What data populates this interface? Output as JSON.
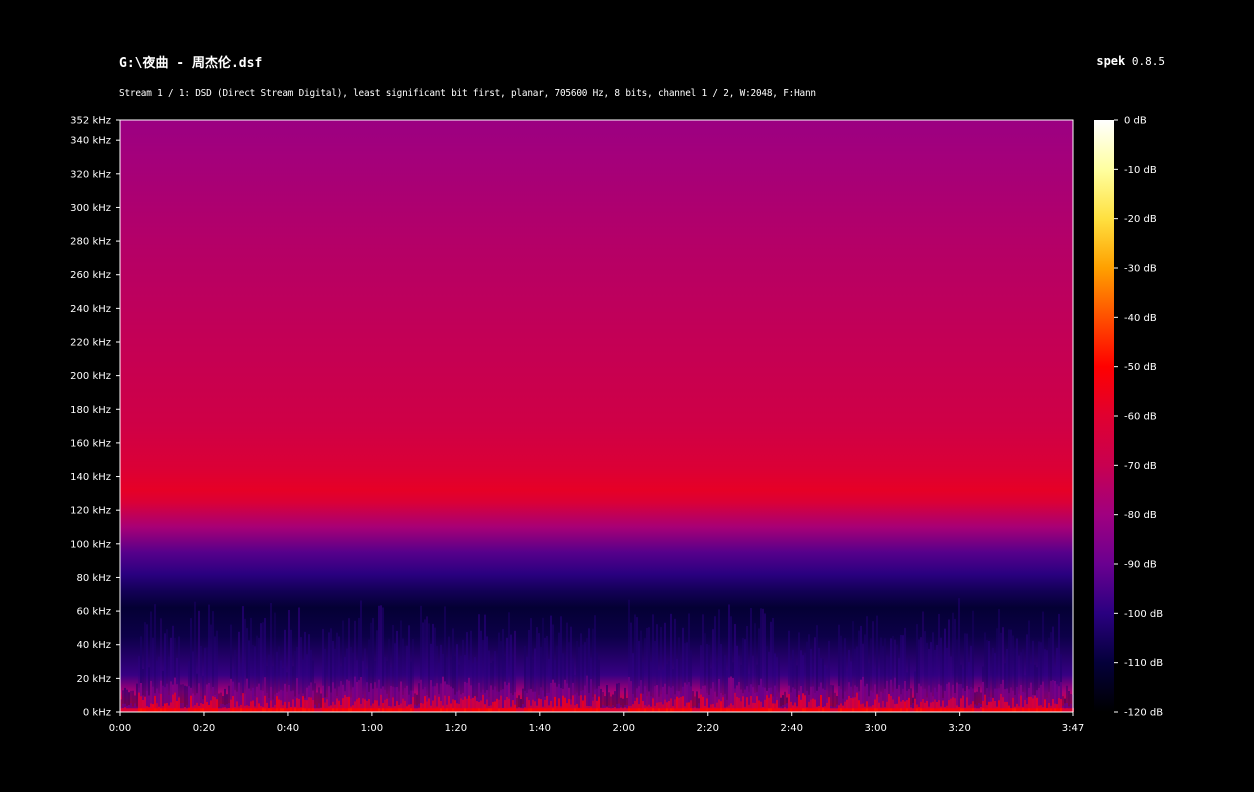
{
  "header": {
    "file_title": "G:\\夜曲 - 周杰伦.dsf",
    "app_name": "spek",
    "app_version": "0.8.5",
    "stream_info": "Stream 1 / 1: DSD (Direct Stream Digital), least significant bit first, planar, 705600 Hz, 8 bits, channel 1 / 2, W:2048, F:Hann"
  },
  "chart_data": {
    "type": "heatmap",
    "x_axis": {
      "unit": "seconds",
      "range": [
        0,
        227
      ],
      "ticks": [
        {
          "value": 0,
          "label": "0:00"
        },
        {
          "value": 20,
          "label": "0:20"
        },
        {
          "value": 40,
          "label": "0:40"
        },
        {
          "value": 60,
          "label": "1:00"
        },
        {
          "value": 80,
          "label": "1:20"
        },
        {
          "value": 100,
          "label": "1:40"
        },
        {
          "value": 120,
          "label": "2:00"
        },
        {
          "value": 140,
          "label": "2:20"
        },
        {
          "value": 160,
          "label": "2:40"
        },
        {
          "value": 180,
          "label": "3:00"
        },
        {
          "value": 200,
          "label": "3:20"
        },
        {
          "value": 227,
          "label": "3:47"
        }
      ]
    },
    "y_axis": {
      "unit": "kHz",
      "range": [
        0,
        352
      ],
      "ticks": [
        {
          "value": 0,
          "label": "0 kHz"
        },
        {
          "value": 20,
          "label": "20 kHz"
        },
        {
          "value": 40,
          "label": "40 kHz"
        },
        {
          "value": 60,
          "label": "60 kHz"
        },
        {
          "value": 80,
          "label": "80 kHz"
        },
        {
          "value": 100,
          "label": "100 kHz"
        },
        {
          "value": 120,
          "label": "120 kHz"
        },
        {
          "value": 140,
          "label": "140 kHz"
        },
        {
          "value": 160,
          "label": "160 kHz"
        },
        {
          "value": 180,
          "label": "180 kHz"
        },
        {
          "value": 200,
          "label": "200 kHz"
        },
        {
          "value": 220,
          "label": "220 kHz"
        },
        {
          "value": 240,
          "label": "240 kHz"
        },
        {
          "value": 260,
          "label": "260 kHz"
        },
        {
          "value": 280,
          "label": "280 kHz"
        },
        {
          "value": 300,
          "label": "300 kHz"
        },
        {
          "value": 320,
          "label": "320 kHz"
        },
        {
          "value": 340,
          "label": "340 kHz"
        },
        {
          "value": 352,
          "label": "352 kHz"
        }
      ]
    },
    "color_scale": {
      "unit": "dB",
      "range": [
        -120,
        0
      ],
      "ticks": [
        {
          "value": 0,
          "label": "0 dB"
        },
        {
          "value": -10,
          "label": "-10 dB"
        },
        {
          "value": -20,
          "label": "-20 dB"
        },
        {
          "value": -30,
          "label": "-30 dB"
        },
        {
          "value": -40,
          "label": "-40 dB"
        },
        {
          "value": -50,
          "label": "-50 dB"
        },
        {
          "value": -60,
          "label": "-60 dB"
        },
        {
          "value": -70,
          "label": "-70 dB"
        },
        {
          "value": -80,
          "label": "-80 dB"
        },
        {
          "value": -90,
          "label": "-90 dB"
        },
        {
          "value": -100,
          "label": "-100 dB"
        },
        {
          "value": -110,
          "label": "-110 dB"
        },
        {
          "value": -120,
          "label": "-120 dB"
        }
      ],
      "palette": [
        {
          "db": 0,
          "color": "#ffffff"
        },
        {
          "db": -10,
          "color": "#ffffa0"
        },
        {
          "db": -20,
          "color": "#ffe040"
        },
        {
          "db": -30,
          "color": "#ffa000"
        },
        {
          "db": -40,
          "color": "#ff5000"
        },
        {
          "db": -50,
          "color": "#ff0000"
        },
        {
          "db": -60,
          "color": "#e00030"
        },
        {
          "db": -70,
          "color": "#c80050"
        },
        {
          "db": -80,
          "color": "#a00080"
        },
        {
          "db": -90,
          "color": "#6a0090"
        },
        {
          "db": -100,
          "color": "#2a0080"
        },
        {
          "db": -110,
          "color": "#04003a"
        },
        {
          "db": -120,
          "color": "#000000"
        }
      ]
    },
    "frequency_profile": [
      {
        "khz": 0,
        "db": -50
      },
      {
        "khz": 4,
        "db": -58
      },
      {
        "khz": 12,
        "db": -78
      },
      {
        "khz": 22,
        "db": -98
      },
      {
        "khz": 45,
        "db": -108
      },
      {
        "khz": 62,
        "db": -111
      },
      {
        "khz": 72,
        "db": -106
      },
      {
        "khz": 82,
        "db": -100
      },
      {
        "khz": 95,
        "db": -93
      },
      {
        "khz": 110,
        "db": -78
      },
      {
        "khz": 125,
        "db": -62
      },
      {
        "khz": 132,
        "db": -58
      },
      {
        "khz": 145,
        "db": -62
      },
      {
        "khz": 170,
        "db": -67
      },
      {
        "khz": 220,
        "db": -71
      },
      {
        "khz": 280,
        "db": -75
      },
      {
        "khz": 330,
        "db": -79
      },
      {
        "khz": 352,
        "db": -81
      }
    ],
    "quiet_passages_seconds": [
      [
        0,
        4
      ],
      [
        14,
        16
      ],
      [
        23,
        26
      ],
      [
        46,
        48
      ],
      [
        70,
        71
      ],
      [
        94,
        96
      ],
      [
        114,
        121
      ],
      [
        136,
        138
      ],
      [
        157,
        159
      ],
      [
        169,
        171
      ],
      [
        188,
        189
      ],
      [
        203,
        205
      ],
      [
        224,
        227
      ]
    ]
  }
}
